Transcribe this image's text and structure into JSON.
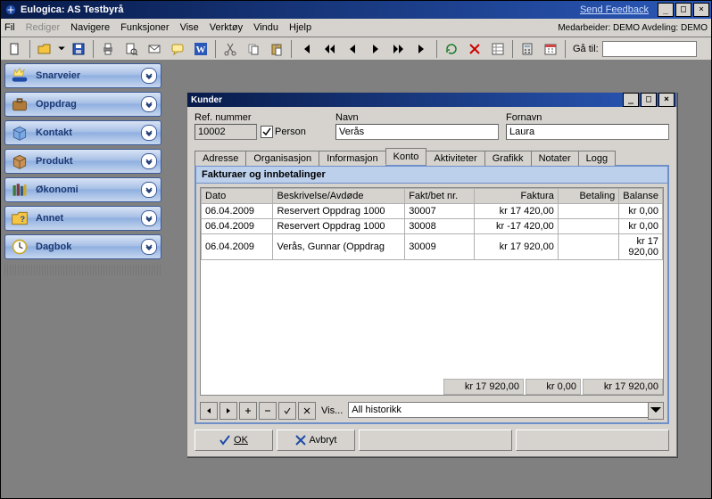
{
  "app": {
    "title": "Eulogica: AS Testbyrå",
    "feedback_link": "Send Feedback",
    "status_user": "Medarbeider: DEMO  Avdeling: DEMO"
  },
  "menu": {
    "items": [
      "Fil",
      "Rediger",
      "Navigere",
      "Funksjoner",
      "Vise",
      "Verktøy",
      "Vindu",
      "Hjelp"
    ],
    "goto_label": "Gå til:",
    "goto_value": ""
  },
  "sidebar": {
    "items": [
      {
        "label": "Snarveier"
      },
      {
        "label": "Oppdrag"
      },
      {
        "label": "Kontakt"
      },
      {
        "label": "Produkt"
      },
      {
        "label": "Økonomi"
      },
      {
        "label": "Annet"
      },
      {
        "label": "Dagbok"
      }
    ]
  },
  "child": {
    "title": "Kunder",
    "ref_label": "Ref. nummer",
    "ref_value": "10002",
    "person_label": "Person",
    "navn_label": "Navn",
    "navn_value": "Verås",
    "fornavn_label": "Fornavn",
    "fornavn_value": "Laura"
  },
  "tabs": {
    "items": [
      "Adresse",
      "Organisasjon",
      "Informasjon",
      "Konto",
      "Aktiviteter",
      "Grafikk",
      "Notater",
      "Logg"
    ],
    "active_index": 3
  },
  "konto": {
    "panel_title": "Fakturaer og innbetalinger",
    "columns": [
      "Dato",
      "Beskrivelse/Avdøde",
      "Fakt/bet nr.",
      "Faktura",
      "Betaling",
      "Balanse"
    ],
    "rows": [
      {
        "dato": "06.04.2009",
        "besk": "Reservert Oppdrag 1000",
        "nr": "30007",
        "fakt": "kr 17 420,00",
        "bet": "",
        "bal": "kr 0,00"
      },
      {
        "dato": "06.04.2009",
        "besk": "Reservert Oppdrag 1000",
        "nr": "30008",
        "fakt": "kr -17 420,00",
        "bet": "",
        "bal": "kr 0,00"
      },
      {
        "dato": "06.04.2009",
        "besk": "Verås, Gunnar (Oppdrag",
        "nr": "30009",
        "fakt": "kr 17 920,00",
        "bet": "",
        "bal": "kr 17 920,00"
      }
    ],
    "totals": {
      "fakt": "kr 17 920,00",
      "bet": "kr 0,00",
      "bal": "kr 17 920,00"
    },
    "vis_label": "Vis...",
    "vis_value": "All historikk"
  },
  "buttons": {
    "ok": "OK",
    "cancel": "Avbryt"
  }
}
